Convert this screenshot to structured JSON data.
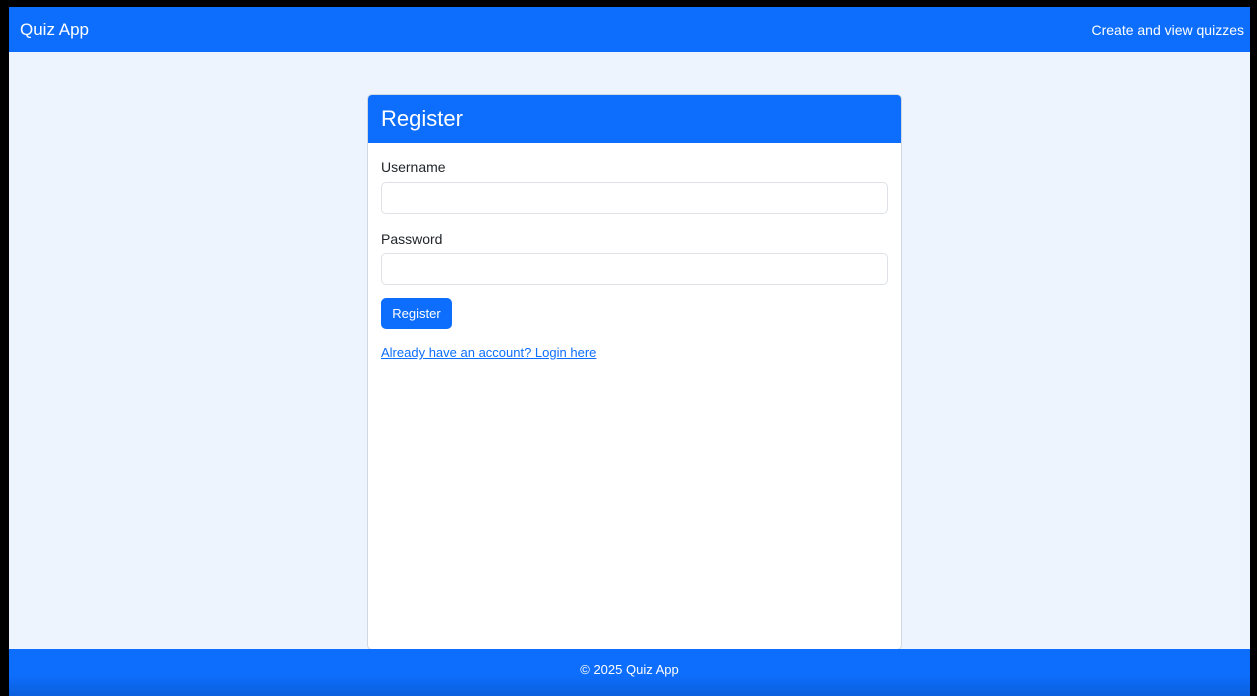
{
  "navbar": {
    "brand": "Quiz App",
    "link": "Create and view quizzes"
  },
  "card": {
    "title": "Register",
    "username_label": "Username",
    "username_value": "",
    "password_label": "Password",
    "password_value": "",
    "submit_label": "Register",
    "login_link": "Already have an account? Login here"
  },
  "footer": {
    "text": "© 2025 Quiz App"
  },
  "colors": {
    "primary": "#0d6efd",
    "page_background": "#eef4fe",
    "card_background": "#ffffff"
  }
}
